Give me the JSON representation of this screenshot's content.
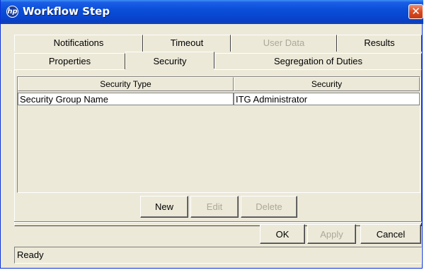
{
  "window": {
    "title": "Workflow Step",
    "app_icon": "hp-logo-icon",
    "close_icon": "close-icon",
    "close_symbol": "✕"
  },
  "tabs": {
    "row_top": [
      {
        "label": "Notifications",
        "disabled": false
      },
      {
        "label": "Timeout",
        "disabled": false
      },
      {
        "label": "User Data",
        "disabled": true
      },
      {
        "label": "Results",
        "disabled": false
      }
    ],
    "row_bottom": [
      {
        "label": "Properties",
        "disabled": false
      },
      {
        "label": "Security",
        "disabled": false,
        "active": true
      },
      {
        "label": "Segregation of Duties",
        "disabled": false
      }
    ]
  },
  "table": {
    "columns": [
      "Security Type",
      "Security"
    ],
    "rows": [
      [
        "Security Group Name",
        "ITG Administrator"
      ]
    ]
  },
  "table_buttons": {
    "new": "New",
    "edit": "Edit",
    "delete": "Delete"
  },
  "dialog_buttons": {
    "ok": "OK",
    "apply": "Apply",
    "cancel": "Cancel"
  },
  "status": {
    "text": "Ready"
  }
}
